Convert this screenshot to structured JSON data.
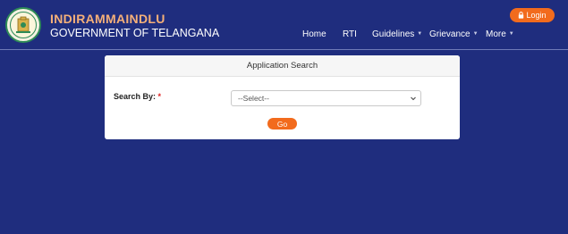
{
  "header": {
    "brand_name": "INDIRAMMAINDLU",
    "brand_subtitle": "GOVERNMENT OF TELANGANA",
    "login_label": "Login",
    "logo_icon": "telangana-emblem-icon"
  },
  "nav": {
    "items": [
      {
        "label": "Home",
        "has_dropdown": false
      },
      {
        "label": "RTI",
        "has_dropdown": false
      },
      {
        "label": "Guidelines",
        "has_dropdown": true
      },
      {
        "label": "Grievance",
        "has_dropdown": true
      },
      {
        "label": "More",
        "has_dropdown": true
      }
    ]
  },
  "search_card": {
    "title": "Application Search",
    "search_by_label": "Search By:",
    "required_mark": "*",
    "select_value": "--Select--",
    "go_label": "Go"
  },
  "colors": {
    "background": "#1f2d7e",
    "accent": "#f26b1d",
    "brand_name": "#f5b079"
  }
}
